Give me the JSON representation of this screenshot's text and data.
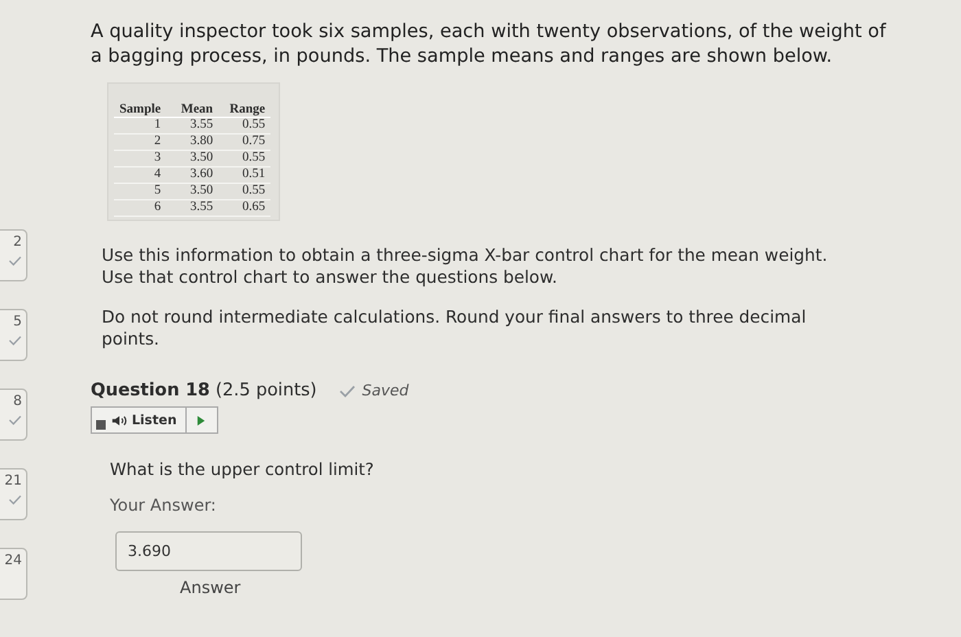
{
  "intro": "A quality inspector took six samples, each with twenty observations, of the weight of a bagging process, in pounds. The sample means and ranges are shown below.",
  "table": {
    "columns": [
      "Sample",
      "Mean",
      "Range"
    ],
    "rows": [
      [
        "1",
        "3.55",
        "0.55"
      ],
      [
        "2",
        "3.80",
        "0.75"
      ],
      [
        "3",
        "3.50",
        "0.55"
      ],
      [
        "4",
        "3.60",
        "0.51"
      ],
      [
        "5",
        "3.50",
        "0.55"
      ],
      [
        "6",
        "3.55",
        "0.65"
      ]
    ]
  },
  "instructions": [
    "Use this information to obtain a three-sigma X-bar control chart for the mean weight. Use that control chart to answer the questions below.",
    "Do not round intermediate calculations. Round your final answers to three decimal points."
  ],
  "question_nav": [
    {
      "label": "2",
      "answered": true
    },
    {
      "label": "5",
      "answered": true
    },
    {
      "label": "8",
      "answered": true
    },
    {
      "label": "21",
      "answered": true
    },
    {
      "label": "24",
      "answered": false
    }
  ],
  "question": {
    "title": "Question 18",
    "points": "(2.5 points)",
    "saved": true,
    "saved_label": "Saved",
    "listen_label": "Listen",
    "prompt": "What is the upper control limit?",
    "answer_label": "Your Answer:",
    "answer_value": "3.690",
    "answer_caption": "Answer"
  }
}
